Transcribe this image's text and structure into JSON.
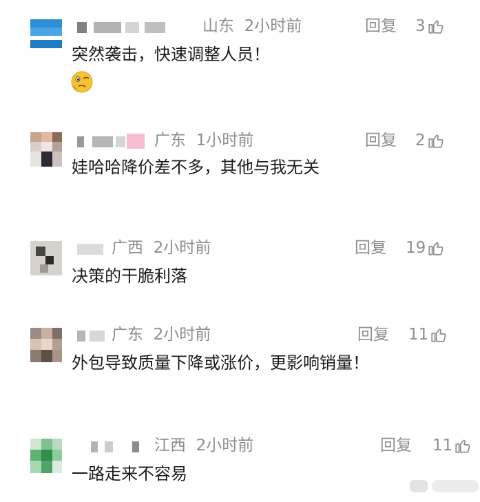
{
  "comments": [
    {
      "region": "山东",
      "time": "2小时前",
      "reply_label": "回复",
      "likes": "3",
      "text": "突然袭击，快速调整人员！",
      "emoji": "thinking-face"
    },
    {
      "region": "广东",
      "time": "1小时前",
      "reply_label": "回复",
      "likes": "2",
      "text": "娃哈哈降价差不多，其他与我无关"
    },
    {
      "region": "广西",
      "time": "2小时前",
      "reply_label": "回复",
      "likes": "19",
      "text": "决策的干脆利落"
    },
    {
      "region": "广东",
      "time": "2小时前",
      "reply_label": "回复",
      "likes": "11",
      "text": "外包导致质量下降或涨价，更影响销量！"
    },
    {
      "region": "江西",
      "time": "2小时前",
      "reply_label": "回复",
      "likes": "11",
      "text": "一路走来不容易"
    }
  ],
  "colors": {
    "meta_gray": "#8e8e8e",
    "text_dark": "#1c1c1c",
    "emoji_yellow": "#f7c231"
  },
  "icons": {
    "like": "thumbs-up-icon",
    "emoji": "thinking-face-icon"
  }
}
